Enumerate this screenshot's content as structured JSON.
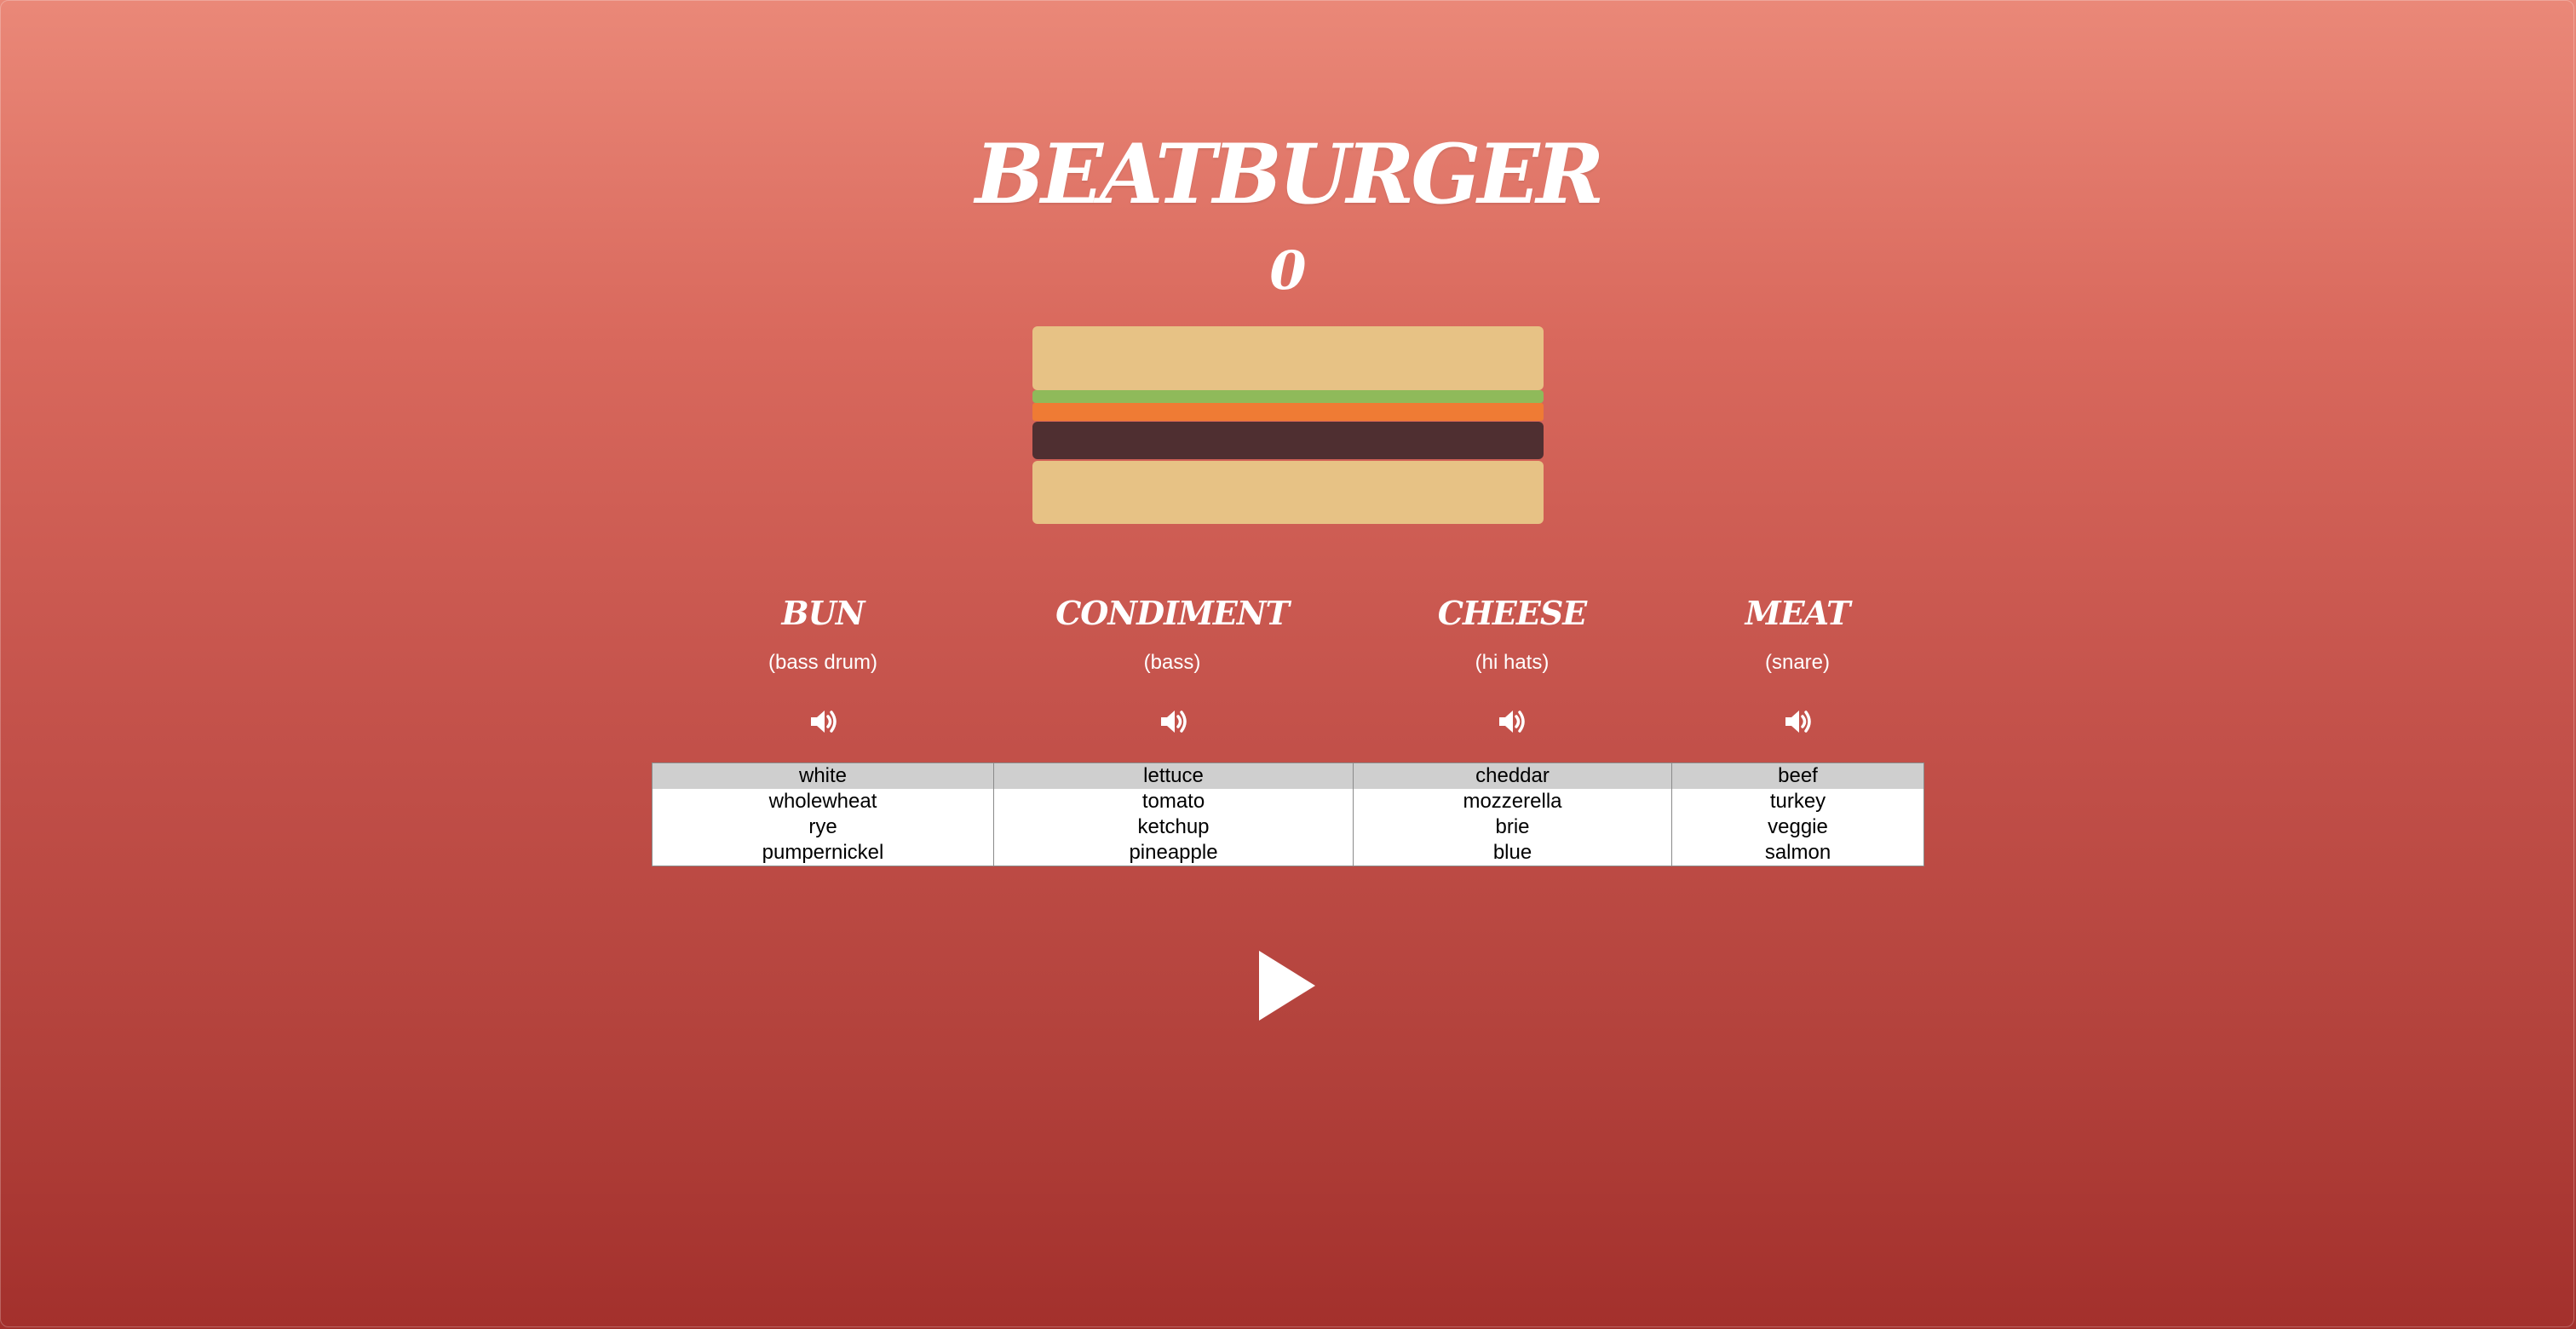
{
  "app": {
    "title": "BEATBURGER",
    "score": "0"
  },
  "colors": {
    "background_top": "#ea8878",
    "background_bottom": "#a3302c",
    "bun": "#e7c285",
    "lettuce": "#8fba5a",
    "tomato": "#ef7b34",
    "patty": "#4f2f31",
    "selected_option": "#cfcfcf"
  },
  "columns": [
    {
      "title": "BUN",
      "instrument": "(bass drum)",
      "icon": "speaker-icon",
      "selected": "white",
      "options": [
        "white",
        "wholewheat",
        "rye",
        "pumpernickel"
      ]
    },
    {
      "title": "CONDIMENT",
      "instrument": "(bass)",
      "icon": "speaker-icon",
      "selected": "lettuce",
      "options": [
        "lettuce",
        "tomato",
        "ketchup",
        "pineapple"
      ]
    },
    {
      "title": "CHEESE",
      "instrument": "(hi hats)",
      "icon": "speaker-icon",
      "selected": "cheddar",
      "options": [
        "cheddar",
        "mozzerella",
        "brie",
        "blue"
      ]
    },
    {
      "title": "MEAT",
      "instrument": "(snare)",
      "icon": "speaker-icon",
      "selected": "beef",
      "options": [
        "beef",
        "turkey",
        "veggie",
        "salmon"
      ]
    }
  ],
  "controls": {
    "play_icon": "play-icon"
  }
}
